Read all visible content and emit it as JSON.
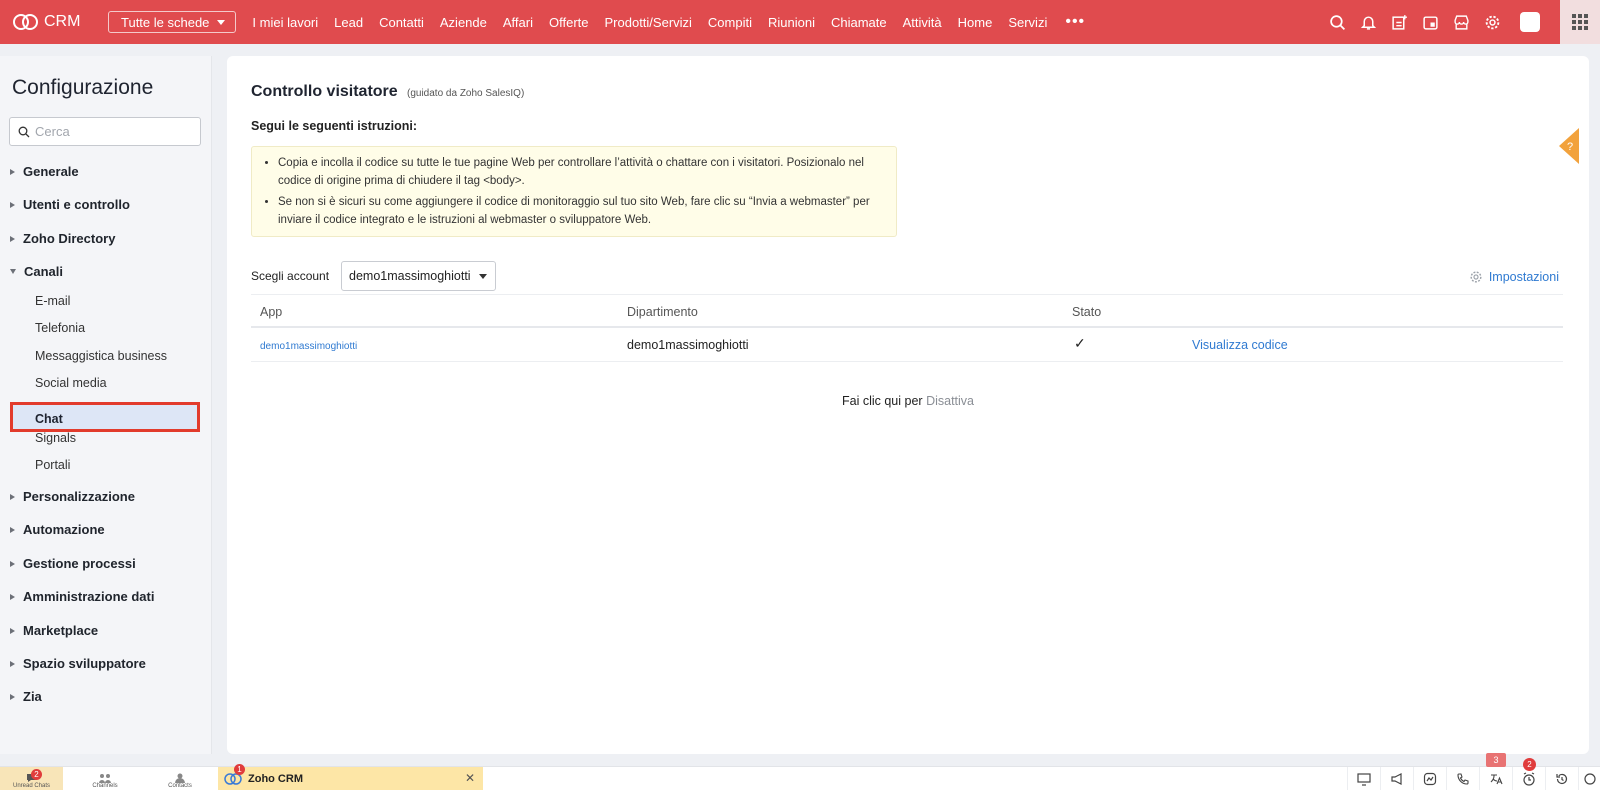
{
  "topbar": {
    "app_name": "CRM",
    "all_modules": "Tutte le schede",
    "nav": [
      "I miei lavori",
      "Lead",
      "Contatti",
      "Aziende",
      "Affari",
      "Offerte",
      "Prodotti/Servizi",
      "Compiti",
      "Riunioni",
      "Chiamate",
      "Attività",
      "Home",
      "Servizi"
    ],
    "more": "•••",
    "icons": [
      "search-icon",
      "bell-icon",
      "add-note-icon",
      "calendar-icon",
      "marketplace-icon",
      "gear-icon",
      "avatar",
      "apps-grid-icon"
    ]
  },
  "sidebar": {
    "title": "Configurazione",
    "search_placeholder": "Cerca",
    "sections": [
      "Generale",
      "Utenti e controllo",
      "Zoho Directory",
      "Canali"
    ],
    "canali_items": [
      "E-mail",
      "Telefonia",
      "Messaggistica business",
      "Social media",
      "Chat",
      "Signals",
      "Portali"
    ],
    "sections_after": [
      "Personalizzazione",
      "Automazione",
      "Gestione processi",
      "Amministrazione dati",
      "Marketplace",
      "Spazio sviluppatore",
      "Zia"
    ]
  },
  "main": {
    "title": "Controllo visitatore",
    "subtitle": "(guidato da Zoho SalesIQ)",
    "instructions_heading": "Segui le seguenti istruzioni:",
    "note_1": "Copia e incolla il codice su tutte le tue pagine Web per controllare l’attività o chattare con i visitatori. Posizionalo nel codice di origine prima di chiudere il tag <body>.",
    "note_2": "Se non si è sicuri su come aggiungere il codice di monitoraggio sul tuo sito Web, fare clic su “Invia a webmaster” per inviare il codice integrato e le istruzioni al webmaster o sviluppatore Web.",
    "account_label": "Scegli account",
    "account_value": "demo1massimoghiotti",
    "settings_label": "Impostazioni",
    "table": {
      "headers": [
        "App",
        "Dipartimento",
        "Stato"
      ],
      "rows": [
        {
          "app": "demo1massimoghiotti",
          "department": "demo1massimoghiotti",
          "status": "✓",
          "action": "Visualizza codice"
        }
      ]
    },
    "deactivate_text": "Fai clic qui per",
    "deactivate_link": "Disattiva"
  },
  "bottombar": {
    "unread_chats": "Unread Chats",
    "unread_badge": "2",
    "channels": "Channels",
    "contacts": "Contacts",
    "tab_name": "Zoho CRM",
    "tab_badge": "1",
    "tab_close": "✕",
    "icon_badge_3": "3",
    "icon_badge_2": "2"
  }
}
